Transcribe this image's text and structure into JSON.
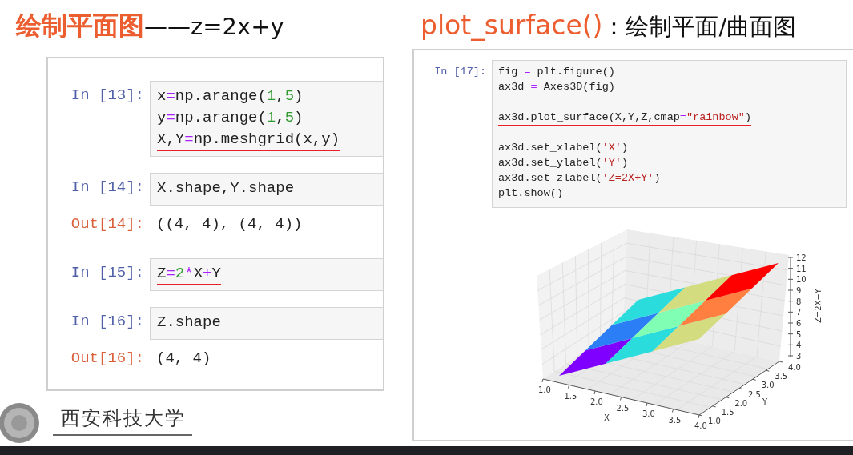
{
  "left_title": "**绘制平面图**——z=2x+y",
  "right_title": "**plot_surface()**：绘制平面/曲面图",
  "left_notebook": {
    "cells": [
      {
        "kind": "input",
        "prompt": "In [13]:",
        "lines": [
          {
            "text": "x=np.arange(1,5)",
            "underlined": false
          },
          {
            "text": "y=np.arange(1,5)",
            "underlined": false
          },
          {
            "text": "X,Y=np.meshgrid(x,y)",
            "underlined": true
          }
        ]
      },
      {
        "kind": "input",
        "prompt": "In [14]:",
        "lines": [
          {
            "text": "X.shape,Y.shape",
            "underlined": false
          }
        ]
      },
      {
        "kind": "output",
        "prompt": "Out[14]:",
        "text": "((4, 4), (4, 4))"
      },
      {
        "kind": "input",
        "prompt": "In [15]:",
        "lines": [
          {
            "text": "Z=2*X+Y",
            "underlined": true
          }
        ]
      },
      {
        "kind": "input",
        "prompt": "In [16]:",
        "lines": [
          {
            "text": "Z.shape",
            "underlined": false
          }
        ]
      },
      {
        "kind": "output",
        "prompt": "Out[16]:",
        "text": "(4, 4)"
      }
    ]
  },
  "logo": {
    "name": "西安科技大学"
  },
  "right_notebook": {
    "cells": [
      {
        "kind": "input",
        "prompt": "In [17]:",
        "blocks": [
          {
            "lines": [
              {
                "text": "fig = plt.figure()",
                "underlined": false
              },
              {
                "text": "ax3d = Axes3D(fig)",
                "underlined": false
              }
            ]
          },
          {
            "lines": [
              {
                "text": "ax3d.plot_surface(X,Y,Z,cmap=\"rainbow\")",
                "underlined": true
              }
            ]
          },
          {
            "lines": [
              {
                "text": "ax3d.set_xlabel('X')",
                "underlined": false
              },
              {
                "text": "ax3d.set_ylabel('Y')",
                "underlined": false
              },
              {
                "text": "ax3d.set_zlabel('Z=2X+Y')",
                "underlined": false
              },
              {
                "text": "plt.show()",
                "underlined": false
              }
            ]
          }
        ]
      }
    ]
  },
  "plot": {
    "xlabel": "X",
    "ylabel": "Y",
    "zlabel": "Z=2X+Y",
    "xticks": [
      "1.0",
      "1.5",
      "2.0",
      "2.5",
      "3.0",
      "3.5",
      "4.0"
    ],
    "yticks": [
      "1.0",
      "1.5",
      "2.0",
      "2.5",
      "3.0",
      "3.5",
      "4.0"
    ],
    "zticks": [
      "12",
      "11",
      "10",
      "9",
      "8",
      "7",
      "6",
      "5",
      "4",
      "3"
    ]
  }
}
